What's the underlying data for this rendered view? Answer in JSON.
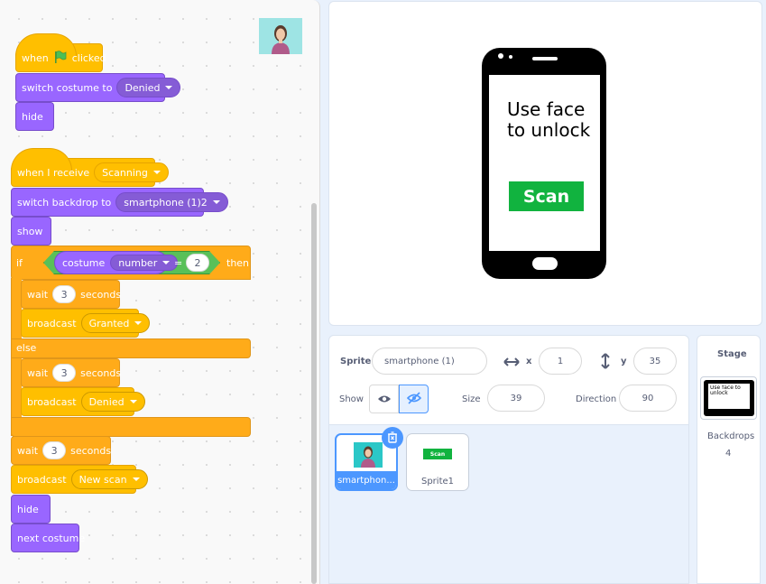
{
  "scripts": {
    "script1": {
      "hat_when": "when",
      "hat_clicked": "clicked",
      "switch_costume_label": "switch costume to",
      "switch_costume_value": "Denied",
      "hide_label": "hide"
    },
    "script2": {
      "hat_label": "when I receive",
      "hat_value": "Scanning",
      "switch_backdrop_label": "switch backdrop to",
      "switch_backdrop_value": "smartphone (1)2",
      "show_label": "show",
      "if_label": "if",
      "then_label": "then",
      "costume_label": "costume",
      "costume_value": "number",
      "equals": "=",
      "compare_value": "2",
      "wait1_label": "wait",
      "wait1_value": "3",
      "wait1_unit": "seconds",
      "broadcast1_label": "broadcast",
      "broadcast1_value": "Granted",
      "else_label": "else",
      "wait2_label": "wait",
      "wait2_value": "3",
      "wait2_unit": "seconds",
      "broadcast2_label": "broadcast",
      "broadcast2_value": "Denied",
      "wait3_label": "wait",
      "wait3_value": "3",
      "wait3_unit": "seconds",
      "broadcast3_label": "broadcast",
      "broadcast3_value": "New scan",
      "hide_label": "hide",
      "next_costume_label": "next costume"
    }
  },
  "stage": {
    "phone_text": "Use face to unlock",
    "scan_button": "Scan"
  },
  "sprite_info": {
    "sprite_label": "Sprite",
    "sprite_name": "smartphone (1)",
    "x_label": "x",
    "x_value": "1",
    "y_label": "y",
    "y_value": "35",
    "show_label": "Show",
    "size_label": "Size",
    "size_value": "39",
    "direction_label": "Direction",
    "direction_value": "90"
  },
  "sprites": [
    {
      "name": "smartphon...",
      "selected": true
    },
    {
      "name": "Sprite1",
      "selected": false
    }
  ],
  "sprite1_thumb_text": "Scan",
  "stage_panel": {
    "title": "Stage",
    "thumb_text": "Use face to unlock",
    "backdrops_label": "Backdrops",
    "backdrops_count": "4"
  },
  "colors": {
    "events": "#ffbf00",
    "control": "#ffab19",
    "looks": "#9966ff",
    "operators": "#59c059",
    "accent": "#4c97ff",
    "scan_green": "#11b33f"
  }
}
